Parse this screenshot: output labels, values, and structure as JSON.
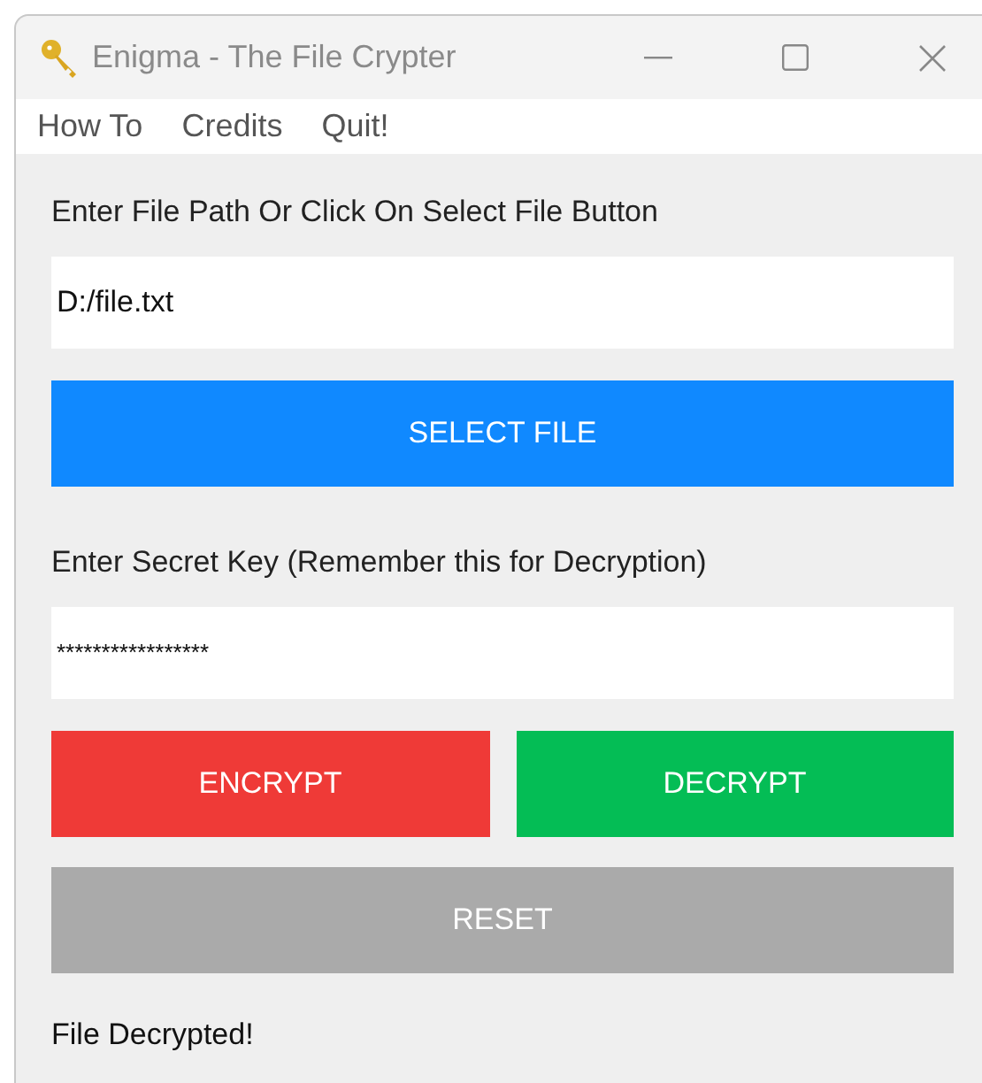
{
  "window": {
    "title": "Enigma - The File Crypter"
  },
  "menu": [
    "How To",
    "Credits",
    "Quit!"
  ],
  "file_label": "Enter File Path Or Click On Select File Button",
  "file_field": {
    "value": "D:/file.txt"
  },
  "select_button": "SELECT FILE",
  "key_label": "Enter Secret Key (Remember this for Decryption)",
  "key_field": {
    "value": "*****************"
  },
  "buttons": [
    {
      "label": "ENCRYPT",
      "color": "#ef3a37"
    },
    {
      "label": "DECRYPT",
      "color": "#04bd55"
    }
  ],
  "reset_button": "RESET",
  "status": "File Decrypted!"
}
